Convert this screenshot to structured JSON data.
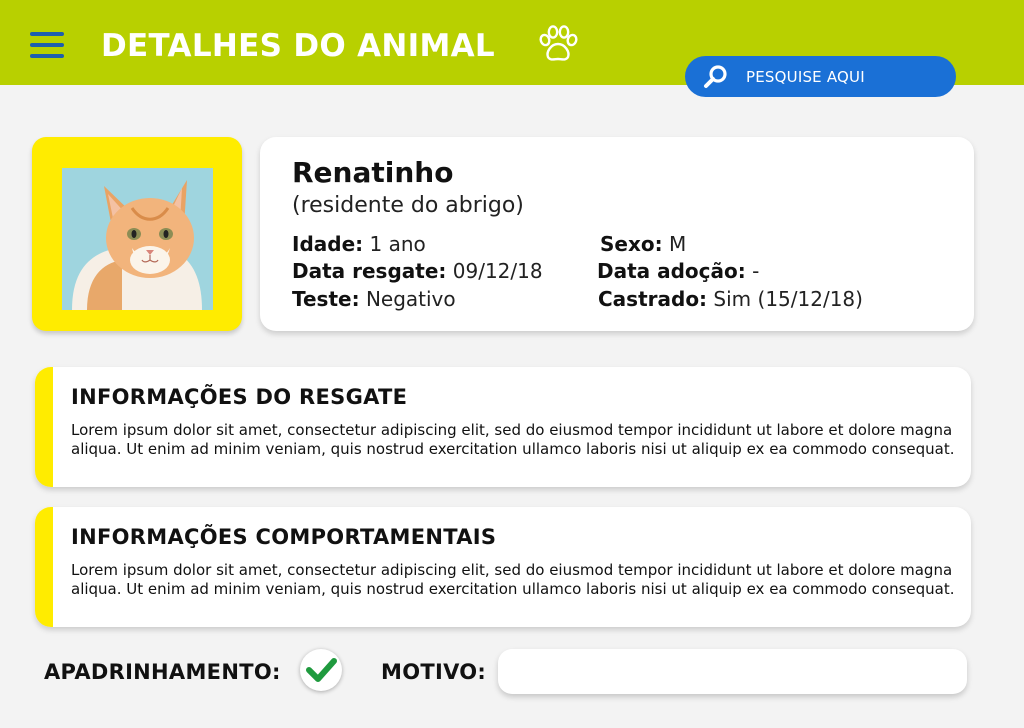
{
  "header": {
    "title": "DETALHES DO ANIMAL",
    "menu_icon": "hamburger-menu-icon",
    "paw_icon": "paw-print-icon",
    "search": {
      "placeholder": "PESQUISE AQUI",
      "icon": "search-icon"
    }
  },
  "animal": {
    "name": "Renatinho",
    "status": "(residente do abrigo)",
    "photo": "orange-and-white-cat-photo",
    "fields": {
      "idade": {
        "label": "Idade:",
        "value": "1 ano"
      },
      "sexo": {
        "label": "Sexo:",
        "value": "M"
      },
      "data_resgate": {
        "label": "Data resgate:",
        "value": "09/12/18"
      },
      "data_adocao": {
        "label": "Data adoção:",
        "value": "-"
      },
      "teste": {
        "label": "Teste:",
        "value": "Negativo"
      },
      "castrado": {
        "label": "Castrado:",
        "value": "Sim (15/12/18)"
      }
    }
  },
  "sections": [
    {
      "title": "INFORMAÇÕES DO RESGATE",
      "text": "Lorem ipsum dolor sit amet, consectetur adipiscing elit, sed do eiusmod tempor incididunt ut labore et dolore magna aliqua. Ut enim ad minim veniam, quis nostrud exercitation ullamco laboris nisi ut aliquip ex ea commodo consequat."
    },
    {
      "title": "INFORMAÇÕES COMPORTAMENTAIS",
      "text": "Lorem ipsum dolor sit amet, consectetur adipiscing elit, sed do eiusmod tempor incididunt ut labore et dolore magna aliqua. Ut enim ad minim veniam, quis nostrud exercitation ullamco laboris nisi ut aliquip ex ea commodo consequat."
    }
  ],
  "footer": {
    "apadrinhamento_label": "APADRINHAMENTO:",
    "apadrinhamento_checked": true,
    "motivo_label": "MOTIVO:",
    "motivo_value": ""
  },
  "colors": {
    "header_bg": "#b8d000",
    "accent_yellow": "#ffec00",
    "search_blue": "#1a70d6",
    "menu_blue": "#1e5fae",
    "check_green": "#1f9a3e",
    "page_bg": "#f3f3f3"
  }
}
